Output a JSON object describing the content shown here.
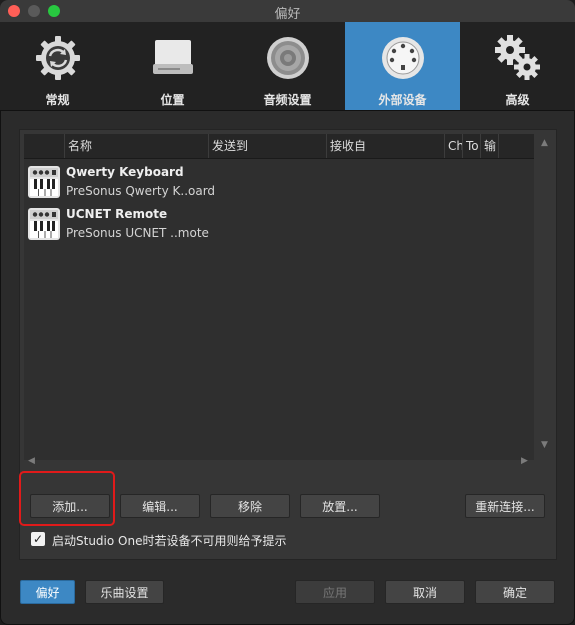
{
  "window": {
    "title": "偏好"
  },
  "tabs": [
    {
      "label": "常规",
      "icon": "refresh-icon"
    },
    {
      "label": "位置",
      "icon": "drive-icon"
    },
    {
      "label": "音频设置",
      "icon": "speaker-icon"
    },
    {
      "label": "外部设备",
      "icon": "midi-port-icon",
      "active": true
    },
    {
      "label": "高级",
      "icon": "gears-icon"
    }
  ],
  "table": {
    "columns": [
      "名称",
      "发送到",
      "接收自",
      "Ch",
      "To",
      "输"
    ],
    "rows": [
      {
        "name": "Qwerty Keyboard",
        "device": "PreSonus Qwerty K..oard"
      },
      {
        "name": "UCNET Remote",
        "device": "PreSonus UCNET ..mote"
      }
    ]
  },
  "actions": {
    "add": "添加...",
    "edit": "编辑...",
    "remove": "移除",
    "place": "放置...",
    "reconnect": "重新连接..."
  },
  "checkbox": {
    "label": "启动Studio One时若设备不可用则给予提示",
    "checked": true
  },
  "footer": {
    "prefs": "偏好",
    "song_settings": "乐曲设置",
    "apply": "应用",
    "cancel": "取消",
    "ok": "确定"
  },
  "colors": {
    "accent": "#3d88c4",
    "highlight": "#e01a1a"
  }
}
